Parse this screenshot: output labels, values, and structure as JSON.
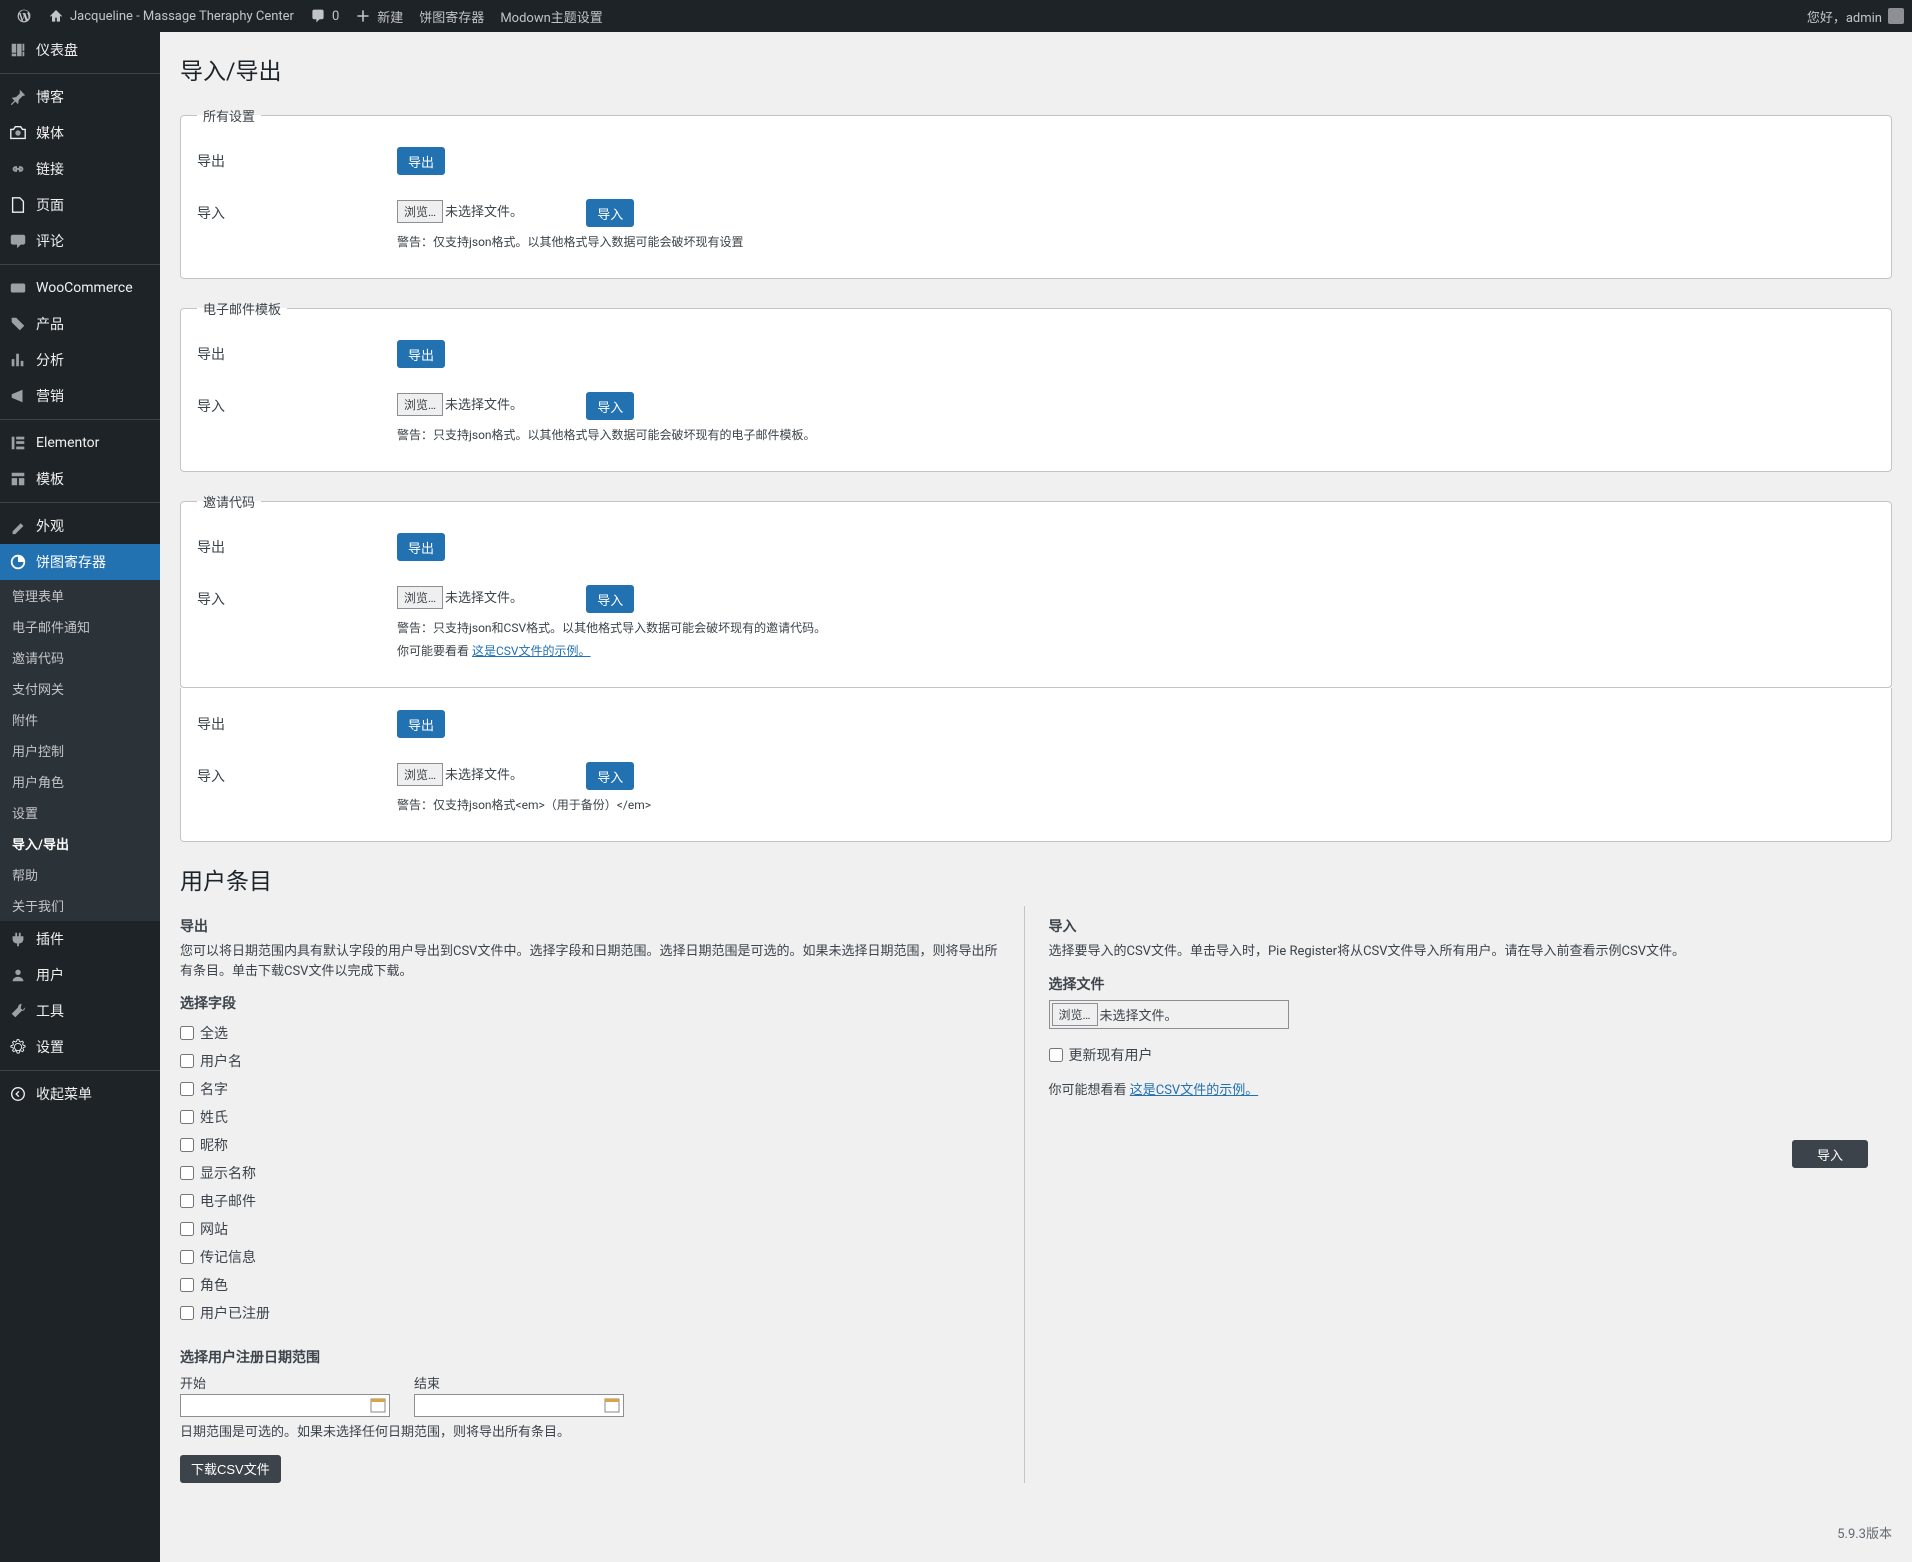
{
  "adminbar": {
    "site": "Jacqueline - Massage Theraphy Center",
    "comments": "0",
    "new": "新建",
    "pie": "饼图寄存器",
    "modown": "Modown主题设置",
    "greeting": "您好，admin"
  },
  "menu": {
    "dashboard": "仪表盘",
    "blog": "博客",
    "media": "媒体",
    "links": "链接",
    "pages": "页面",
    "comments": "评论",
    "woo": "WooCommerce",
    "products": "产品",
    "analytics": "分析",
    "marketing": "营销",
    "elementor": "Elementor",
    "templates": "模板",
    "appearance": "外观",
    "pie": "饼图寄存器",
    "plugins": "插件",
    "users": "用户",
    "tools": "工具",
    "settings": "设置",
    "collapse": "收起菜单"
  },
  "submenu": {
    "manage_form": "管理表单",
    "email_notify": "电子邮件通知",
    "invite_code": "邀请代码",
    "gateway": "支付网关",
    "attachments": "附件",
    "user_control": "用户控制",
    "user_role": "用户角色",
    "settings": "设置",
    "import_export": "导入/导出",
    "help": "帮助",
    "about": "关于我们"
  },
  "page": {
    "title": "导入/导出",
    "export_label": "导出",
    "import_label": "导入",
    "export_btn": "导出",
    "import_btn": "导入",
    "browse": "浏览…",
    "no_file": "未选择文件。"
  },
  "fs_all": {
    "legend": "所有设置",
    "warn": "警告：仅支持json格式。以其他格式导入数据可能会破坏现有设置"
  },
  "fs_email": {
    "legend": "电子邮件模板",
    "warn": "警告：只支持json格式。以其他格式导入数据可能会破坏现有的电子邮件模板。"
  },
  "fs_invite": {
    "legend": "邀请代码",
    "warn": "警告：只支持json和CSV格式。以其他格式导入数据可能会破坏现有的邀请代码。",
    "hint_prefix": "你可能要看看 ",
    "hint_link": "这是CSV文件的示例。"
  },
  "fs_backup": {
    "warn": "警告：仅支持json格式<em>（用于备份）</em>"
  },
  "user_section": {
    "title": "用户条目",
    "export_h": "导出",
    "export_desc": "您可以将日期范围内具有默认字段的用户导出到CSV文件中。选择字段和日期范围。选择日期范围是可选的。如果未选择日期范围，则将导出所有条目。单击下载CSV文件以完成下载。",
    "select_fields": "选择字段",
    "fields": {
      "all": "全选",
      "username": "用户名",
      "firstname": "名字",
      "lastname": "姓氏",
      "nickname": "昵称",
      "displayname": "显示名称",
      "email": "电子邮件",
      "website": "网站",
      "bio": "传记信息",
      "role": "角色",
      "registered": "用户已注册"
    },
    "date_range_h": "选择用户注册日期范围",
    "start": "开始",
    "end": "结束",
    "date_note": "日期范围是可选的。如果未选择任何日期范围，则将导出所有条目。",
    "download_csv": "下载CSV文件",
    "import_h": "导入",
    "import_desc": "选择要导入的CSV文件。单击导入时，Pie Register将从CSV文件导入所有用户。请在导入前查看示例CSV文件。",
    "select_file": "选择文件",
    "update_existing": "更新现有用户",
    "hint_prefix": "你可能想看看 ",
    "hint_link": "这是CSV文件的示例。",
    "import_btn": "导入"
  },
  "footer": {
    "version": "5.9.3版本"
  }
}
